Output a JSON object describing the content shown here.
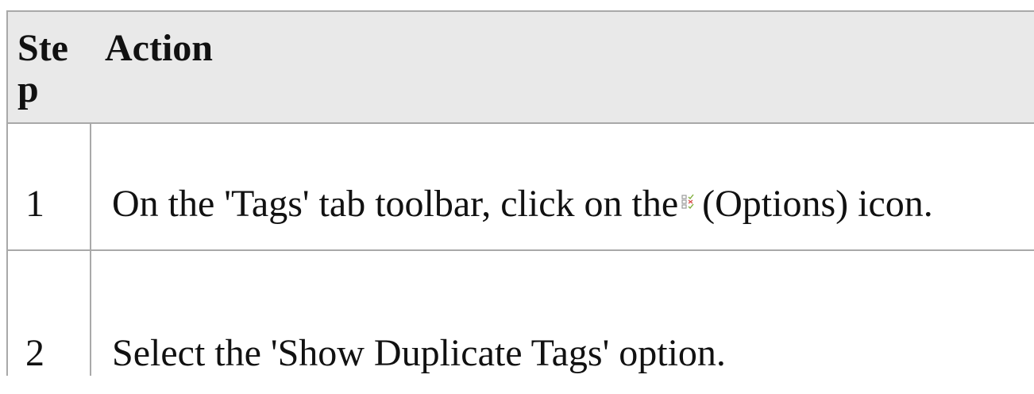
{
  "table": {
    "header": {
      "step": "Step",
      "action": "Action"
    },
    "rows": [
      {
        "step": "1",
        "action_before_icon": "On the 'Tags' tab toolbar, click on the",
        "icon": "options-icon",
        "action_after_icon": "(Options) icon."
      },
      {
        "step": "2",
        "action": "Select the 'Show Duplicate Tags' option."
      }
    ]
  },
  "colors": {
    "header_background": "#e9e9e9",
    "border": "#a9a9a9",
    "text": "#111111"
  }
}
